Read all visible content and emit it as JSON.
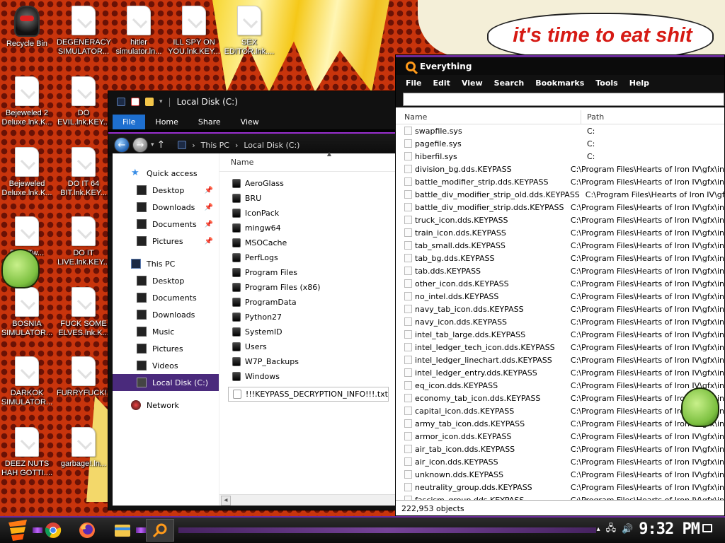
{
  "wallpaper": {
    "speech_text": "it's time to eat shit"
  },
  "desktop_icons": [
    {
      "label": "Recycle Bin"
    },
    {
      "label": "DEGENERACY SIMULATOR..."
    },
    {
      "label": "hitler simulator.ln..."
    },
    {
      "label": "ILL SPY ON YOU.lnk.KEY..."
    },
    {
      "label": "SEX EDITOR.lnk...."
    },
    {
      "label": "Bejeweled 2 Deluxe.lnk.K..."
    },
    {
      "label": "DO EVIL.lnk.KEY..."
    },
    {
      "label": "Bejeweled Deluxe.lnk.K..."
    },
    {
      "label": "DO IT 64 BIT.lnk.KEY..."
    },
    {
      "label": "Be... Tw..."
    },
    {
      "label": "DO IT LIVE.lnk.KEY..."
    },
    {
      "label": "BOSNIA SIMULATOR..."
    },
    {
      "label": "FUCK SOME ELVES.lnk.K..."
    },
    {
      "label": "DARKOK SIMULATOR..."
    },
    {
      "label": "FURRYFUCK!..."
    },
    {
      "label": "DEEZ NUTS HAH GOTTI...."
    },
    {
      "label": "garbage!.ln..."
    }
  ],
  "explorer": {
    "title": "Local Disk (C:)",
    "tabs": [
      "File",
      "Home",
      "Share",
      "View"
    ],
    "breadcrumb": [
      "This PC",
      "Local Disk (C:)"
    ],
    "nav": [
      {
        "label": "Quick access",
        "level": 0,
        "pinned": false
      },
      {
        "label": "Desktop",
        "level": 1,
        "pinned": true
      },
      {
        "label": "Downloads",
        "level": 1,
        "pinned": true
      },
      {
        "label": "Documents",
        "level": 1,
        "pinned": true
      },
      {
        "label": "Pictures",
        "level": 1,
        "pinned": true
      },
      {
        "label": "This PC",
        "level": 0,
        "pinned": false
      },
      {
        "label": "Desktop",
        "level": 1,
        "pinned": false
      },
      {
        "label": "Documents",
        "level": 1,
        "pinned": false
      },
      {
        "label": "Downloads",
        "level": 1,
        "pinned": false
      },
      {
        "label": "Music",
        "level": 1,
        "pinned": false
      },
      {
        "label": "Pictures",
        "level": 1,
        "pinned": false
      },
      {
        "label": "Videos",
        "level": 1,
        "pinned": false
      },
      {
        "label": "Local Disk (C:)",
        "level": 1,
        "pinned": false,
        "selected": true
      },
      {
        "label": "Network",
        "level": 0,
        "pinned": false
      }
    ],
    "column_name": "Name",
    "files": [
      "AeroGlass",
      "BRU",
      "IconPack",
      "mingw64",
      "MSOCache",
      "PerfLogs",
      "Program Files",
      "Program Files (x86)",
      "ProgramData",
      "Python27",
      "SystemID",
      "Users",
      "W7P_Backups",
      "Windows"
    ],
    "selected_file": "!!!KEYPASS_DECRYPTION_INFO!!!.txt"
  },
  "everything": {
    "title": "Everything",
    "menu": [
      "File",
      "Edit",
      "View",
      "Search",
      "Bookmarks",
      "Tools",
      "Help"
    ],
    "search_value": "",
    "columns": [
      "Name",
      "Path"
    ],
    "rows": [
      [
        "swapfile.sys",
        "C:"
      ],
      [
        "pagefile.sys",
        "C:"
      ],
      [
        "hiberfil.sys",
        "C:"
      ],
      [
        "division_bg.dds.KEYPASS",
        "C:\\Program Files\\Hearts of Iron IV\\gfx\\in"
      ],
      [
        "battle_modifier_strip.dds.KEYPASS",
        "C:\\Program Files\\Hearts of Iron IV\\gfx\\in"
      ],
      [
        "battle_div_modifier_strip_old.dds.KEYPASS",
        "C:\\Program Files\\Hearts of Iron IV\\gfx\\in"
      ],
      [
        "battle_div_modifier_strip.dds.KEYPASS",
        "C:\\Program Files\\Hearts of Iron IV\\gfx\\in"
      ],
      [
        "truck_icon.dds.KEYPASS",
        "C:\\Program Files\\Hearts of Iron IV\\gfx\\in"
      ],
      [
        "train_icon.dds.KEYPASS",
        "C:\\Program Files\\Hearts of Iron IV\\gfx\\in"
      ],
      [
        "tab_small.dds.KEYPASS",
        "C:\\Program Files\\Hearts of Iron IV\\gfx\\in"
      ],
      [
        "tab_bg.dds.KEYPASS",
        "C:\\Program Files\\Hearts of Iron IV\\gfx\\in"
      ],
      [
        "tab.dds.KEYPASS",
        "C:\\Program Files\\Hearts of Iron IV\\gfx\\in"
      ],
      [
        "other_icon.dds.KEYPASS",
        "C:\\Program Files\\Hearts of Iron IV\\gfx\\in"
      ],
      [
        "no_intel.dds.KEYPASS",
        "C:\\Program Files\\Hearts of Iron IV\\gfx\\in"
      ],
      [
        "navy_tab_icon.dds.KEYPASS",
        "C:\\Program Files\\Hearts of Iron IV\\gfx\\in"
      ],
      [
        "navy_icon.dds.KEYPASS",
        "C:\\Program Files\\Hearts of Iron IV\\gfx\\in"
      ],
      [
        "intel_tab_large.dds.KEYPASS",
        "C:\\Program Files\\Hearts of Iron IV\\gfx\\in"
      ],
      [
        "intel_ledger_tech_icon.dds.KEYPASS",
        "C:\\Program Files\\Hearts of Iron IV\\gfx\\in"
      ],
      [
        "intel_ledger_linechart.dds.KEYPASS",
        "C:\\Program Files\\Hearts of Iron IV\\gfx\\in"
      ],
      [
        "intel_ledger_entry.dds.KEYPASS",
        "C:\\Program Files\\Hearts of Iron IV\\gfx\\in"
      ],
      [
        "eq_icon.dds.KEYPASS",
        "C:\\Program Files\\Hearts of Iron IV\\gfx\\in"
      ],
      [
        "economy_tab_icon.dds.KEYPASS",
        "C:\\Program Files\\Hearts of Iron IV\\gfx\\in"
      ],
      [
        "capital_icon.dds.KEYPASS",
        "C:\\Program Files\\Hearts of Iron IV\\gfx\\in"
      ],
      [
        "army_tab_icon.dds.KEYPASS",
        "C:\\Program Files\\Hearts of Iron IV\\gfx\\in"
      ],
      [
        "armor_icon.dds.KEYPASS",
        "C:\\Program Files\\Hearts of Iron IV\\gfx\\in"
      ],
      [
        "air_tab_icon.dds.KEYPASS",
        "C:\\Program Files\\Hearts of Iron IV\\gfx\\in"
      ],
      [
        "air_icon.dds.KEYPASS",
        "C:\\Program Files\\Hearts of Iron IV\\gfx\\in"
      ],
      [
        "unknown.dds.KEYPASS",
        "C:\\Program Files\\Hearts of Iron IV\\gfx\\in"
      ],
      [
        "neutrality_group.dds.KEYPASS",
        "C:\\Program Files\\Hearts of Iron IV\\gfx\\in"
      ],
      [
        "fascism_group.dds.KEYPASS",
        "C:\\Program Files\\Hearts of Iron IV\\gfx\\in"
      ]
    ],
    "status": "222,953 objects"
  },
  "taskbar": {
    "apps": [
      "start-icon",
      "chrome-icon",
      "firefox-icon",
      "file-explorer-icon",
      "everything-icon"
    ],
    "active_app": "everything-icon",
    "clock": "9:32 PM"
  }
}
